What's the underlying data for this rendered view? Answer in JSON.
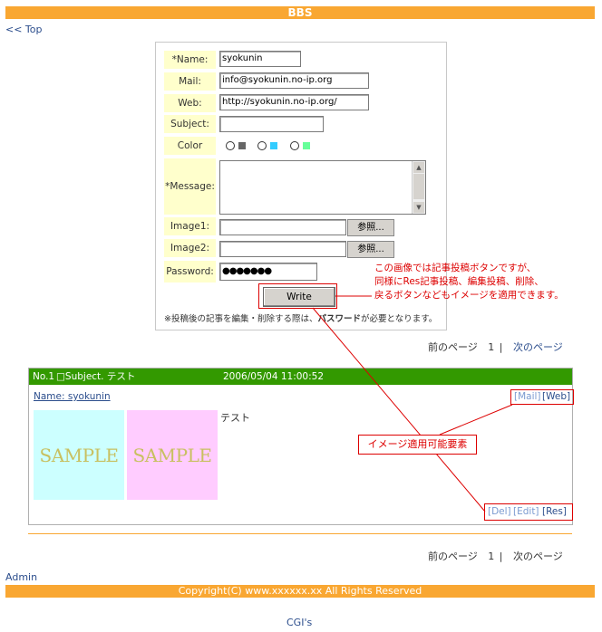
{
  "header": {
    "title": "BBS"
  },
  "nav": {
    "top_link": "<< Top"
  },
  "form": {
    "labels": {
      "name": "*Name:",
      "mail": "Mail:",
      "web": "Web:",
      "subject": "Subject:",
      "color": "Color",
      "message": "*Message:",
      "image1": "Image1:",
      "image2": "Image2:",
      "password": "Password:"
    },
    "values": {
      "name": "syokunin",
      "mail": "info@syokunin.no-ip.org",
      "web": "http://syokunin.no-ip.org/",
      "subject": "",
      "message": "",
      "image1": "",
      "image2": "",
      "password": "●●●●●●●"
    },
    "color_options": [
      "#666666",
      "#33ccff",
      "#66ff99"
    ],
    "browse_label": "参照...",
    "write_label": "Write",
    "note_prefix": "※投稿後の記事を編集・削除する際は、",
    "note_bold": "パスワード",
    "note_suffix": "が必要となります。"
  },
  "annotations": {
    "main_line1": "この画像では記事投稿ボタンですが、",
    "main_line2": "同様にRes記事投稿、編集投稿、削除、",
    "main_line3": "戻るボタンなどもイメージを適用できます。",
    "element_label": "イメージ適用可能要素"
  },
  "pager": {
    "prev": "前のページ",
    "page": "1",
    "sep": "|",
    "next": "次のページ"
  },
  "post": {
    "number": "No.1",
    "subject": "□Subject. テスト",
    "date": "2006/05/04 11:00:52",
    "name": "Name: syokunin",
    "mail_link": "[Mail]",
    "web_link": "[Web]",
    "body": "テスト",
    "image_labels": [
      "SAMPLE",
      "SAMPLE"
    ],
    "image_colors": [
      "#ccffff",
      "#ffccff"
    ],
    "del_link": "[Del]",
    "edit_link": "[Edit]",
    "res_link": "[Res]"
  },
  "footer": {
    "admin_link": "Admin",
    "copyright": "Copyright(C) www.xxxxxx.xx All Rights Reserved",
    "cgis": "CGI's"
  },
  "colors": {
    "accent": "#f9a732",
    "post_header": "#339900",
    "label_bg": "#ffffcc",
    "annotation": "#dd0000"
  }
}
